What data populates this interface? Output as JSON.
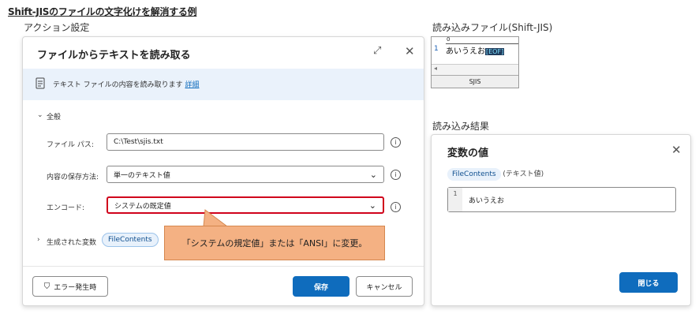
{
  "page_title": "Shift-JISのファイルの文字化けを解消する例",
  "labels": {
    "action_settings": "アクション設定",
    "read_file": "読み込みファイル(Shift-JIS)",
    "read_result": "読み込み結果"
  },
  "dialog": {
    "title": "ファイルからテキストを読み取る",
    "info_text": "テキスト ファイルの内容を読み取ります",
    "info_link": "詳細",
    "section": "全般",
    "file_path_label": "ファイル パス:",
    "file_path_value": "C:\\Test\\sjis.txt",
    "store_label": "内容の保存方法:",
    "store_value": "単一のテキスト値",
    "encoding_label": "エンコード:",
    "encoding_value": "システムの既定値",
    "generated_label": "生成された変数",
    "generated_var": "FileContents",
    "error_button": "エラー発生時",
    "save_button": "保存",
    "cancel_button": "キャンセル",
    "highlight_color": "#d0021b"
  },
  "callout": "「システムの規定値」または「ANSI」に変更。",
  "file_preview": {
    "ruler": "0",
    "line_number": "1",
    "content": "あいうえお",
    "eof": "[EOF]",
    "encoding": "SJIS"
  },
  "result_dialog": {
    "title": "変数の値",
    "variable": "FileContents",
    "variable_type": "(テキスト値)",
    "line_number": "1",
    "value": "あいうえお",
    "close_button": "閉じる"
  }
}
